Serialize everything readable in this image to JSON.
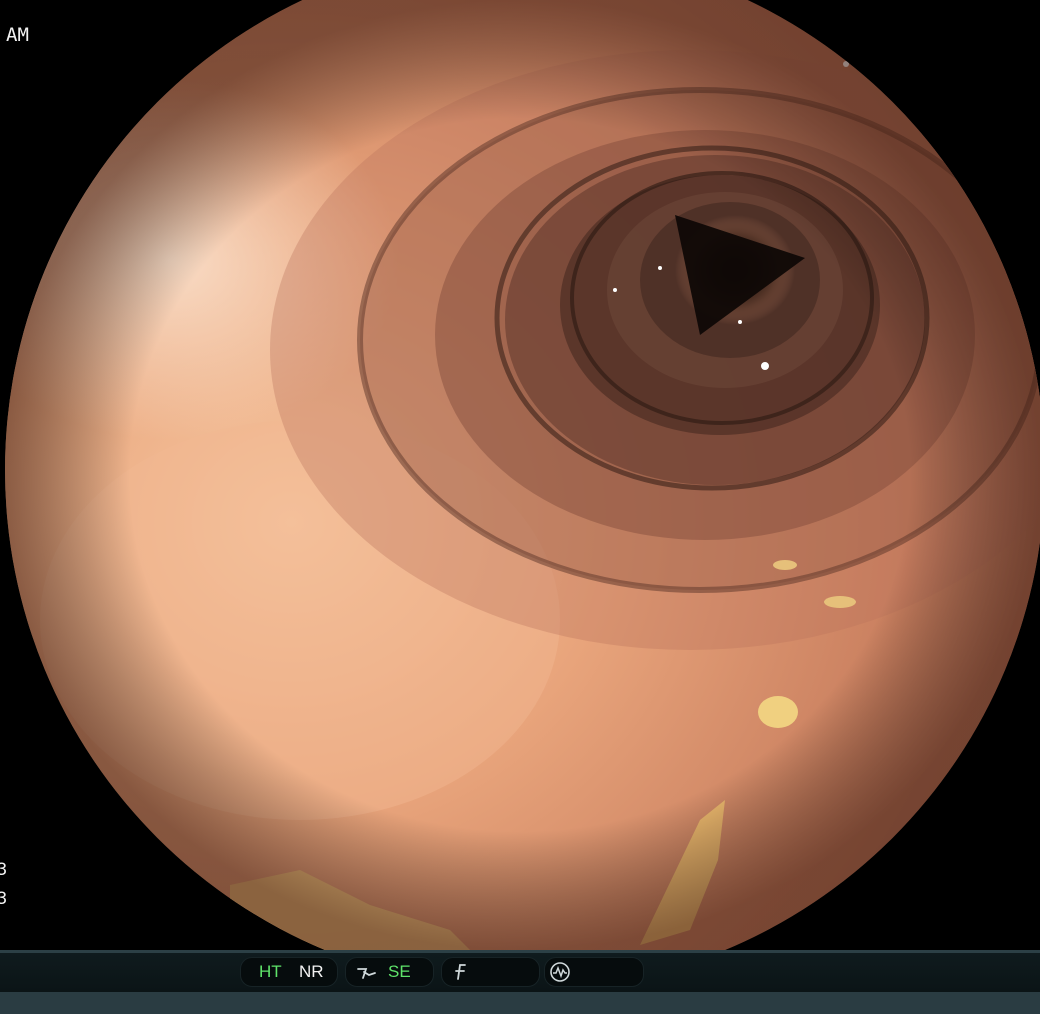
{
  "overlay": {
    "top_left": "AM",
    "left_marker_1": "3",
    "left_marker_2": "3"
  },
  "status_bar": {
    "ht_label": "HT",
    "nr_label": "NR",
    "se_label": "SE",
    "ht_color": "#5fe36a",
    "se_color": "#5fe36a",
    "icons": [
      "color-enhance-icon",
      "freeze-icon",
      "waveform-icon"
    ]
  }
}
